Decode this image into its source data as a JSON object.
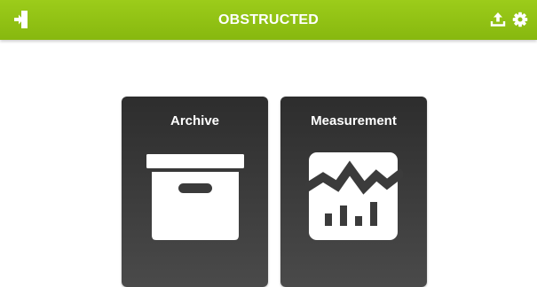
{
  "header": {
    "title": "OBSTRUCTED",
    "background": "#93c31a",
    "left_icon": "exit-icon",
    "right_icons": [
      "upload-icon",
      "settings-gear-icon"
    ]
  },
  "tiles": [
    {
      "label": "Archive",
      "icon": "archive-box-icon"
    },
    {
      "label": "Measurement",
      "icon": "measurement-chart-icon"
    }
  ],
  "colors": {
    "tile_background": "#3a3a3a",
    "icon_foreground": "#ffffff"
  }
}
